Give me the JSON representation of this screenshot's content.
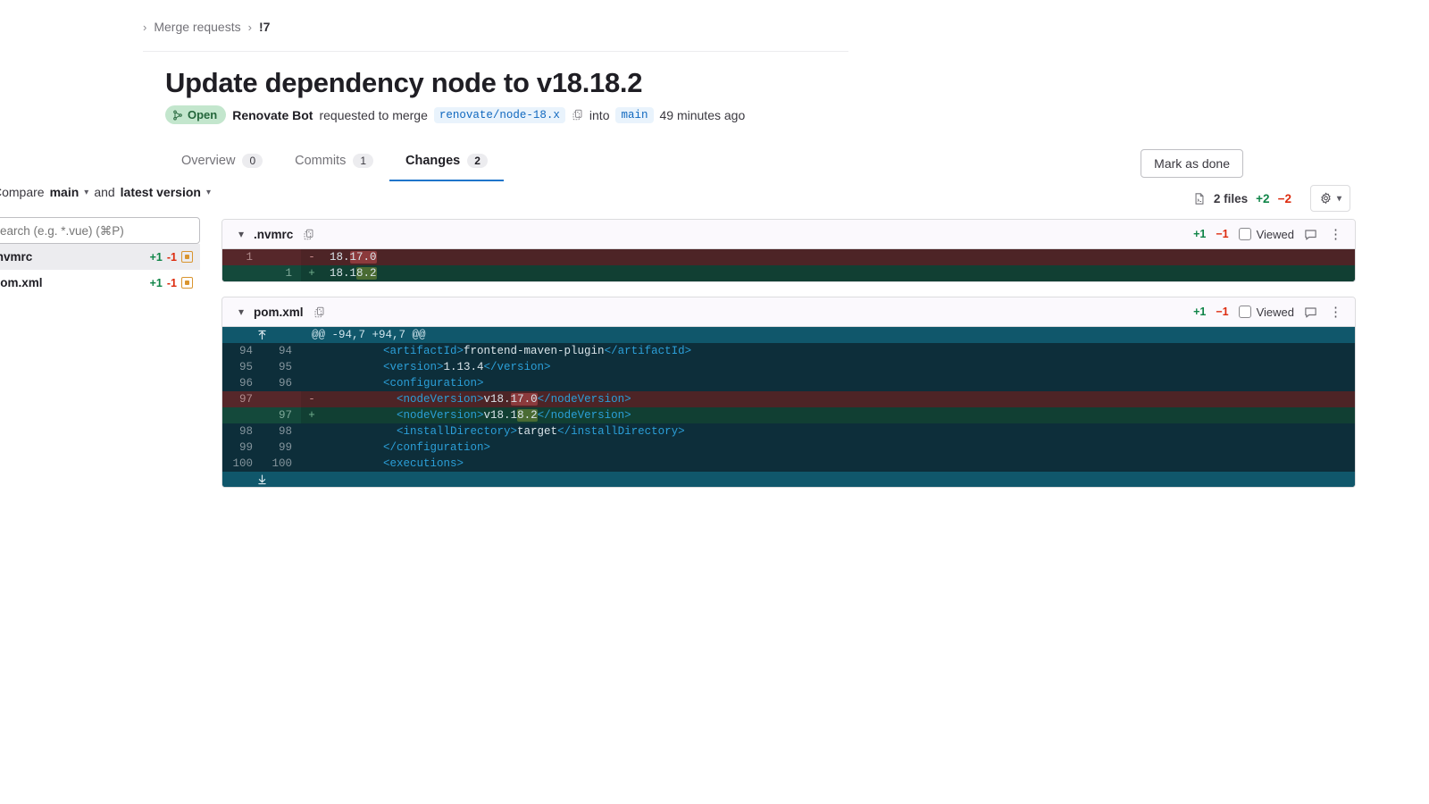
{
  "breadcrumb": {
    "root_sep": "›",
    "item": "Merge requests",
    "sep": "›",
    "current": "!7"
  },
  "header": {
    "title": "Update dependency node to v18.18.2",
    "status_badge": "Open",
    "author": "Renovate Bot",
    "action_text": "requested to merge",
    "source_branch": "renovate/node-18.x",
    "into_text": "into",
    "target_branch": "main",
    "timestamp": "49 minutes ago"
  },
  "tabs": [
    {
      "label": "Overview",
      "count": "0",
      "active": false
    },
    {
      "label": "Commits",
      "count": "1",
      "active": false
    },
    {
      "label": "Changes",
      "count": "2",
      "active": true
    }
  ],
  "actions": {
    "mark_as_done": "Mark as done"
  },
  "compare": {
    "prefix": "Compare",
    "base": "main",
    "conjunction": "and",
    "head": "latest version",
    "files_count": "2 files",
    "additions": "+2",
    "deletions": "−2"
  },
  "sidebar": {
    "search_placeholder": "Search (e.g. *.vue) (⌘P)",
    "files": [
      {
        "name": ".nvmrc",
        "additions": "+1",
        "deletions": "-1",
        "selected": true
      },
      {
        "name": "pom.xml",
        "additions": "+1",
        "deletions": "-1",
        "selected": false
      }
    ]
  },
  "diff_files": [
    {
      "name": ".nvmrc",
      "additions": "+1",
      "deletions": "−1",
      "viewed_label": "Viewed",
      "lines": [
        {
          "type": "del",
          "old": "1",
          "new": "",
          "sign": "-",
          "prefix": "18.",
          "highlight": "17.0",
          "suffix": ""
        },
        {
          "type": "add",
          "old": "",
          "new": "1",
          "sign": "+",
          "prefix": "18.1",
          "highlight": "8.2",
          "suffix": ""
        }
      ]
    },
    {
      "name": "pom.xml",
      "additions": "+1",
      "deletions": "−1",
      "viewed_label": "Viewed",
      "hunk_header": "@@ -94,7 +94,7 @@",
      "lines": [
        {
          "type": "ctx",
          "old": "94",
          "new": "94",
          "sign": "",
          "indent": "        ",
          "open_tag": "<artifactId>",
          "text": "frontend-maven-plugin",
          "close_tag": "</artifactId>"
        },
        {
          "type": "ctx",
          "old": "95",
          "new": "95",
          "sign": "",
          "indent": "        ",
          "open_tag": "<version>",
          "text": "1.13.4",
          "close_tag": "</version>"
        },
        {
          "type": "ctx",
          "old": "96",
          "new": "96",
          "sign": "",
          "indent": "        ",
          "open_tag": "<configuration>",
          "text": "",
          "close_tag": ""
        },
        {
          "type": "del",
          "old": "97",
          "new": "",
          "sign": "-",
          "indent": "          ",
          "open_tag": "<nodeVersion>",
          "text": "v18.",
          "highlight": "17.0",
          "close_tag": "</nodeVersion>"
        },
        {
          "type": "add",
          "old": "",
          "new": "97",
          "sign": "+",
          "indent": "          ",
          "open_tag": "<nodeVersion>",
          "text": "v18.1",
          "highlight": "8.2",
          "close_tag": "</nodeVersion>"
        },
        {
          "type": "ctx",
          "old": "98",
          "new": "98",
          "sign": "",
          "indent": "          ",
          "open_tag": "<installDirectory>",
          "text": "target",
          "close_tag": "</installDirectory>"
        },
        {
          "type": "ctx",
          "old": "99",
          "new": "99",
          "sign": "",
          "indent": "        ",
          "open_tag": "</configuration>",
          "text": "",
          "close_tag": ""
        },
        {
          "type": "ctx",
          "old": "100",
          "new": "100",
          "sign": "",
          "indent": "        ",
          "open_tag": "<executions>",
          "text": "",
          "close_tag": ""
        }
      ]
    }
  ],
  "colors": {
    "accent": "#1f75cb",
    "added": "#108548",
    "removed": "#dd2b0e",
    "open_badge_bg": "#c3e6cd",
    "diff_bg": "#0f2b36"
  }
}
